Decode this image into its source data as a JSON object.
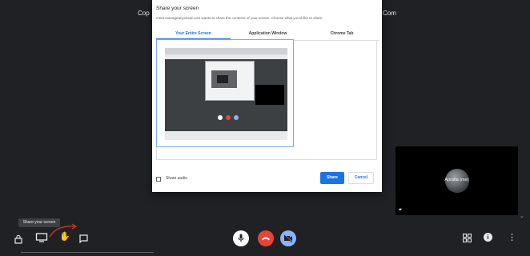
{
  "background": {
    "left_text": "Cop",
    "right_text": "Com"
  },
  "dialog": {
    "title": "Share your screen",
    "subtitle": "meet.manageanycloud.com wants to share the contents of your screen. Choose what you'd like to share.",
    "tabs": [
      {
        "label": "Your Entire Screen",
        "active": true
      },
      {
        "label": "Application Window",
        "active": false
      },
      {
        "label": "Chrome Tab",
        "active": false
      }
    ],
    "share_audio_label": "Share audio",
    "share_label": "Share",
    "cancel_label": "Cancel"
  },
  "self_view": {
    "name": "Apratia (me)",
    "icon": "monitor-small-icon"
  },
  "tooltip": "Share your screen",
  "toolbar": {
    "left_icons": [
      "lock-icon",
      "present-screen-icon",
      "raise-hand-icon",
      "chat-icon"
    ],
    "center_icons": [
      "microphone-icon",
      "end-call-icon",
      "camera-off-icon"
    ],
    "right_icons": [
      "grid-icon",
      "info-icon",
      "more-vert-icon"
    ]
  },
  "colors": {
    "accent": "#1a73e8",
    "end_call": "#ea4335",
    "camera_button": "#8ab4f8",
    "background": "#202124"
  }
}
